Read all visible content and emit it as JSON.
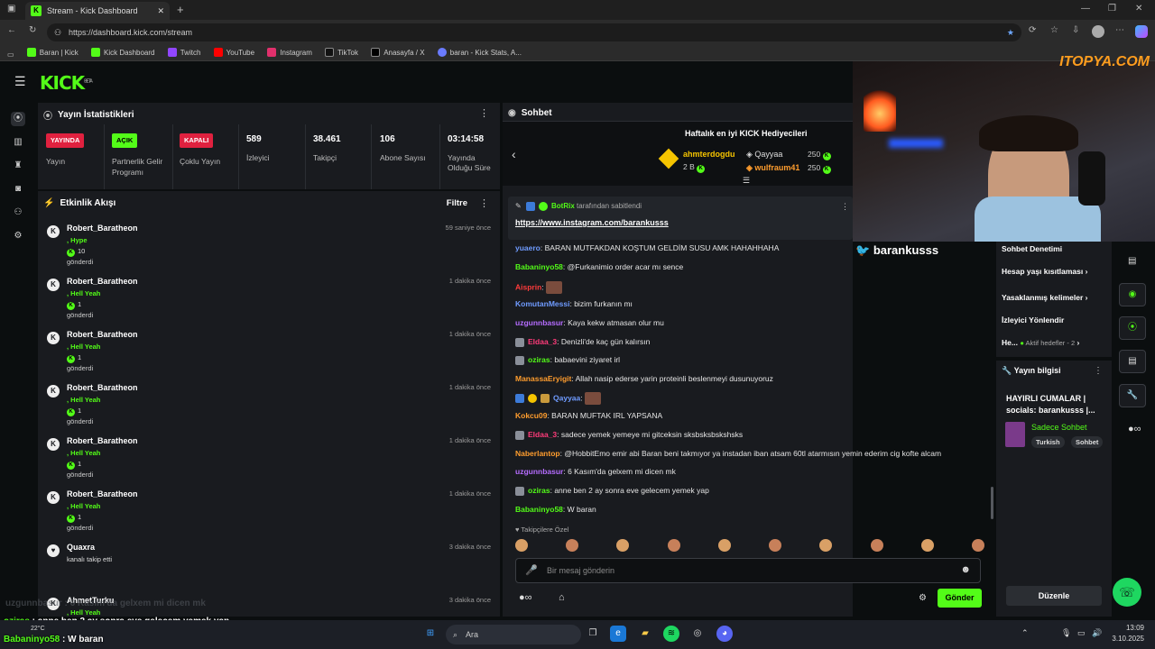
{
  "browser": {
    "tab_title": "Stream - Kick Dashboard",
    "url": "https://dashboard.kick.com/stream",
    "bookmarks": [
      "Baran | Kick",
      "Kick Dashboard",
      "Twitch",
      "YouTube",
      "Instagram",
      "TikTok",
      "Anasayfa / X",
      "baran - Kick Stats, A..."
    ]
  },
  "app": {
    "logo": "KICK",
    "logo_sup": "BETA"
  },
  "stats": {
    "title": "Yayın İstatistikleri",
    "live_badge": "YAYINDA",
    "live_label": "Yayın",
    "partner_badge": "AÇIK",
    "partner_label": "Partnerlik Gelir Programı",
    "multi_badge": "KAPALI",
    "multi_label": "Çoklu Yayın",
    "viewers_value": "589",
    "viewers_label": "İzleyici",
    "followers_value": "38.461",
    "followers_label": "Takipçi",
    "subs_value": "106",
    "subs_label": "Abone Sayısı",
    "uptime_value": "03:14:58",
    "uptime_label": "Yayında Olduğu Süre"
  },
  "activity": {
    "title": "Etkinlik Akışı",
    "filter": "Filtre",
    "items": [
      {
        "name": "Robert_Baratheon",
        "sub": ", Hype",
        "amount": "10",
        "action": "gönderdi",
        "time": "59 saniye önce"
      },
      {
        "name": "Robert_Baratheon",
        "sub": ", Hell Yeah",
        "amount": "1",
        "action": "gönderdi",
        "time": "1 dakika önce"
      },
      {
        "name": "Robert_Baratheon",
        "sub": ", Hell Yeah",
        "amount": "1",
        "action": "gönderdi",
        "time": "1 dakika önce"
      },
      {
        "name": "Robert_Baratheon",
        "sub": ", Hell Yeah",
        "amount": "1",
        "action": "gönderdi",
        "time": "1 dakika önce"
      },
      {
        "name": "Robert_Baratheon",
        "sub": ", Hell Yeah",
        "amount": "1",
        "action": "gönderdi",
        "time": "1 dakika önce"
      },
      {
        "name": "Robert_Baratheon",
        "sub": ", Hell Yeah",
        "amount": "1",
        "action": "gönderdi",
        "time": "1 dakika önce"
      },
      {
        "name": "Quaxra",
        "sub": "",
        "amount": "",
        "action": "kanalı takip etti",
        "time": "3 dakika önce"
      },
      {
        "name": "AhmetTurku",
        "sub": ", Hell Yeah",
        "amount": "1",
        "action": "",
        "time": "3 dakika önce"
      }
    ]
  },
  "chat": {
    "title": "Sohbet",
    "leaderboard_title": "Haftalık en iyi KICK Hediyecileri",
    "top1_name": "ahmterdogdu",
    "top1_amount": "2 B",
    "top2_name": "Qayyaa",
    "top2_amount": "250",
    "top3_name": "wulfraum41",
    "top3_amount": "250",
    "pinned_by": "BotRix",
    "pinned_suffix": "tarafından sabitlendi",
    "pinned_link": "https://www.instagram.com/barankusss",
    "messages": [
      {
        "user": "yuaero",
        "color": "#6f9bff",
        "text": "BARAN MUTFAKDAN KOŞTUM GELDİM SUSU AMK HAHAHHAHA"
      },
      {
        "user": "Babaninyo58",
        "color": "#53fc18",
        "text": "@Furkanimio order acar mı sence"
      },
      {
        "user": "Aisprin",
        "color": "#ff3b3b",
        "text": ""
      },
      {
        "user": "KomutanMessi",
        "color": "#6f9bff",
        "text": "bizim furkanın mı"
      },
      {
        "user": "uzgunnbasur",
        "color": "#b56cff",
        "text": "Kaya kekw atmasan olur mu"
      },
      {
        "user": "Eldaa_3",
        "color": "#ff3b7a",
        "text": "Denizli'de kaç gün kalırsın"
      },
      {
        "user": "oziras",
        "color": "#53fc18",
        "text": "babaevini ziyaret irl"
      },
      {
        "user": "ManassaEryigit",
        "color": "#ff9d2e",
        "text": "Allah nasip ederse yarin proteinli beslenmeyi dusunuyoruz"
      },
      {
        "user": "Qayyaa",
        "color": "#6f9bff",
        "text": ""
      },
      {
        "user": "Kokcu09",
        "color": "#ff9d2e",
        "text": "BARAN MUFTAK IRL YAPSANA"
      },
      {
        "user": "Eldaa_3",
        "color": "#ff3b7a",
        "text": "sadece yemek yemeye mi gitceksin sksbsksbskshsks"
      },
      {
        "user": "Naberlantop",
        "color": "#ff9d2e",
        "text": "@HobbitEmo emir abi Baran beni takmıyor ya instadan iban atsam 60tl atarmısın yemin ederim cig kofte alcam"
      },
      {
        "user": "uzgunnbasur",
        "color": "#b56cff",
        "text": "6 Kasım'da gelxem mi dicen mk"
      },
      {
        "user": "oziras",
        "color": "#53fc18",
        "text": "anne ben 2 ay sonra eve gelecem yemek yap"
      },
      {
        "user": "Babaninyo58",
        "color": "#53fc18",
        "text": "W baran"
      }
    ],
    "followers_only": "Takipçilere Özel",
    "input_placeholder": "Bir mesaj gönderin",
    "send": "Gönder"
  },
  "overlay": {
    "handle": "barankusss",
    "watermark": "ITOPYA.COM"
  },
  "right": {
    "moderation": "Sohbet Denetimi",
    "account_age": "Hesap yaşı kısıtlaması",
    "banned_words": "Yasaklanmış kelimeler",
    "viewer_redirect": "İzleyici Yönlendir",
    "goals_short": "He...",
    "goals_status": "Aktif hedefler - 2",
    "stream_info_title": "Yayın bilgisi",
    "stream_title": "HAYIRLI CUMALAR | socials: barankusss |...",
    "category": "Sadece Sohbet",
    "tags": [
      "Turkish",
      "Sohbet"
    ],
    "edit": "Düzenle"
  },
  "bottom_overlay": {
    "ghost": "uzgunnbasur : 6 Kasım'da gelxem mi dicen mk",
    "line1_user": "oziras",
    "line1_text": " : anne ben 2 ay sonra eve gelecem yemek yap",
    "line2_user": "Babaninyo58",
    "line2_text": " : W baran"
  },
  "taskbar": {
    "temp": "22°C",
    "search": "Ara",
    "time": "13:09",
    "date": "3.10.2025"
  }
}
